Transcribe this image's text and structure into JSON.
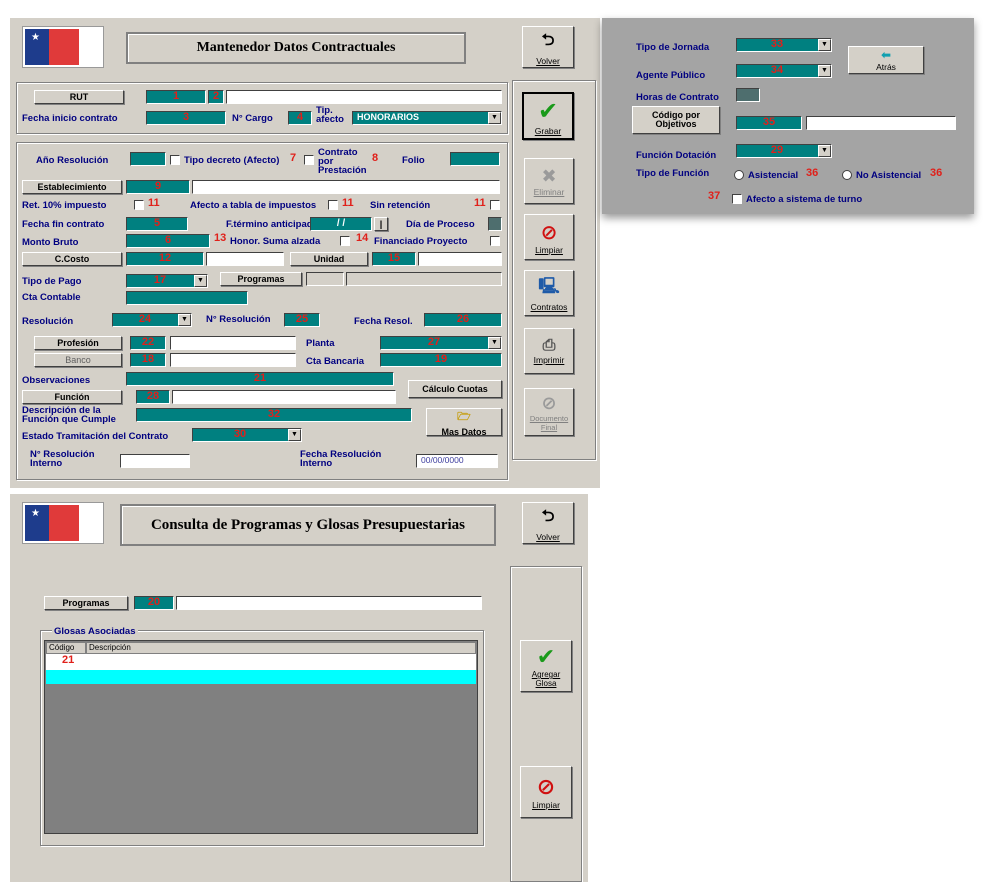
{
  "form1": {
    "title": "Mantenedor Datos Contractuales",
    "rut_button": "RUT",
    "num1": "1",
    "num2": "2",
    "fecha_inicio_label": "Fecha inicio contrato",
    "num3": "3",
    "n_cargo_label": "N° Cargo",
    "num4": "4",
    "tipo_afecto_label": "Tip. afecto",
    "tipo_afecto_value": "HONORARIOS",
    "anio_resolucion_label": "Año Resolución",
    "tipo_decreto_label": "Tipo decreto (Afecto)",
    "num7": "7",
    "contrato_prestacion_label": "Contrato por Prestación",
    "num8": "8",
    "folio_label": "Folio",
    "establecimiento_button": "Establecimiento",
    "num9": "9",
    "ret_label": "Ret. 10% impuesto",
    "num11a": "11",
    "afecto_tabla_label": "Afecto a tabla de impuestos",
    "num11b": "11",
    "sin_retencion_label": "Sin retención",
    "num11c": "11",
    "fecha_fin_label": "Fecha fin contrato",
    "num5": "5",
    "f_termino_label": "F.término anticipado",
    "f_termino_value": "/ /",
    "dia_proceso_label": "Día de Proceso",
    "monto_bruto_label": "Monto Bruto",
    "num6": "6",
    "num13": "13",
    "honor_label": "Honor. Suma alzada",
    "num14": "14",
    "financiado_label": "Financiado Proyecto",
    "ccosto_button": "C.Costo",
    "num12": "12",
    "unidad_button": "Unidad",
    "num15": "15",
    "tipo_pago_label": "Tipo de Pago",
    "num17": "17",
    "programas_button": "Programas",
    "cta_contable_label": "Cta Contable",
    "resolucion_label": "Resolución",
    "num24": "24",
    "n_resolucion_label": "N° Resolución",
    "num25": "25",
    "fecha_resol_label": "Fecha Resol.",
    "num26": "26",
    "profesion_button": "Profesión",
    "num22": "22",
    "planta_label": "Planta",
    "num27": "27",
    "banco_button": "Banco",
    "num18": "18",
    "cta_bancaria_label": "Cta Bancaria",
    "num19": "19",
    "observaciones_label": "Observaciones",
    "num21": "21",
    "calculo_cuotas_button": "Cálculo Cuotas",
    "funcion_button": "Función",
    "num28": "28",
    "descripcion_label": "Descripción de la Función que Cumple",
    "num32": "32",
    "mas_datos_button": "Mas Datos",
    "estado_label": "Estado Tramitación del Contrato",
    "num30": "30",
    "n_resol_interno_label": "N° Resolución Interno",
    "fecha_resol_interno_label": "Fecha Resolución Interno",
    "fecha_resol_interno_value": "00/00/0000",
    "side": {
      "volver": "Volver",
      "grabar": "Grabar",
      "eliminar": "Eliminar",
      "limpiar": "Limpiar",
      "contratos": "Contratos",
      "imprimir": "Imprimir",
      "documento": "Documento Final"
    }
  },
  "form2": {
    "tipo_jornada_label": "Tipo de Jornada",
    "num33": "33",
    "agente_publico_label": "Agente Público",
    "num34": "34",
    "horas_contrato_label": "Horas de Contrato",
    "codigo_button": "Código por Objetivos",
    "num35": "35",
    "atras_button": "Atrás",
    "funcion_dotacion_label": "Función Dotación",
    "num29": "29",
    "tipo_funcion_label": "Tipo de Función",
    "asistencial_label": "Asistencial",
    "num36a": "36",
    "no_asistencial_label": "No Asistencial",
    "num36b": "36",
    "num37": "37",
    "afecto_turno_label": "Afecto a sistema de turno"
  },
  "form3": {
    "title": "Consulta de Programas y Glosas Presupuestarias",
    "volver": "Volver",
    "programas_button": "Programas",
    "num20": "20",
    "glosas_label": "Glosas Asociadas",
    "col_codigo": "Código",
    "col_descripcion": "Descripción",
    "num21": "21",
    "agregar_glosa": "Agregar Glosa",
    "limpiar": "Limpiar"
  }
}
